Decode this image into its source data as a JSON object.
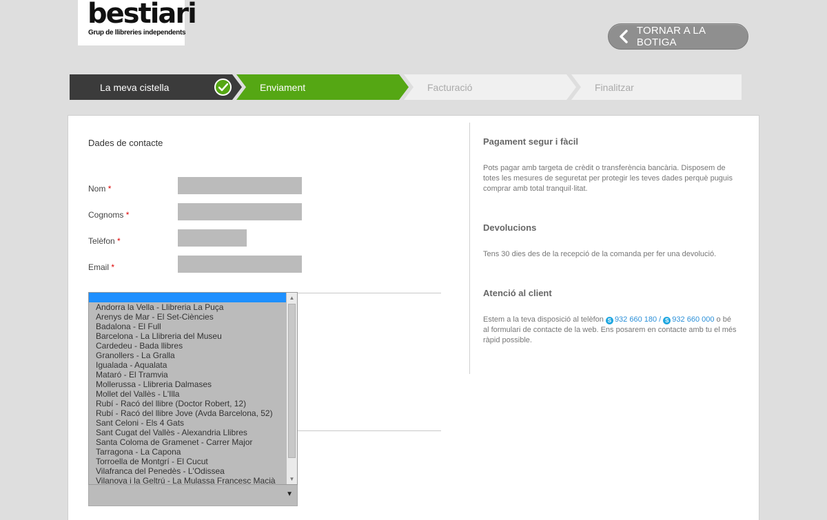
{
  "logo": {
    "word": "bestiari",
    "tagline": "Grup de llibreries independents"
  },
  "header": {
    "back_label": "TORNAR A LA BOTIGA"
  },
  "steps": [
    {
      "label": "La meva cistella",
      "state": "done"
    },
    {
      "label": "Enviament",
      "state": "active"
    },
    {
      "label": "Facturació",
      "state": "pending"
    },
    {
      "label": "Finalitzar",
      "state": "pending"
    }
  ],
  "contact": {
    "title": "Dades de contacte",
    "fields": [
      {
        "label": "Nom",
        "required": "*",
        "value": ""
      },
      {
        "label": "Cognoms",
        "required": "*",
        "value": ""
      },
      {
        "label": "Telèfon",
        "required": "*",
        "value": ""
      },
      {
        "label": "Email",
        "required": "*",
        "value": ""
      }
    ]
  },
  "store_select": {
    "options": [
      "Andorra la Vella - Llibreria La Puça",
      "Arenys de Mar - El Set-Ciències",
      "Badalona - El Full",
      "Barcelona - La Llibreria del Museu",
      "Cardedeu - Bada llibres",
      "Granollers - La Gralla",
      "Igualada - Aqualata",
      "Mataró - El Tramvia",
      "Mollerussa - Llibreria Dalmases",
      "Mollet del Vallès - L'Illa",
      "Rubí - Racó del llibre (Doctor Robert, 12)",
      "Rubí - Racó del llibre Jove (Avda Barcelona, 52)",
      "Sant Celoni - Els 4 Gats",
      "Sant Cugat del Vallès - Alexandria Llibres",
      "Santa Coloma de Gramenet - Carrer Major",
      "Tarragona - La Capona",
      "Torroella de Montgrí - El Cucut",
      "Vilafranca del Penedès - L'Odissea",
      "Vilanova i la Geltrú - La Mulassa Francesc Macià"
    ]
  },
  "sidebar": {
    "secure": {
      "title": "Pagament segur i fàcil",
      "text": "Pots pagar amb targeta de crèdit o transferència bancària. Disposem de totes les mesures de seguretat per protegir les teves dades perquè puguis comprar amb total tranquil·litat."
    },
    "returns": {
      "title": "Devolucions",
      "text": "Tens 30 dies des de la recepció de la comanda per fer una devolució."
    },
    "support": {
      "title": "Atenció al client",
      "text_before": "Estem a la teva disposició al telèfon",
      "phone1": "932 660 180",
      "sep": "/",
      "phone2": "932 660 000",
      "text_after": "o bé al formulari de contacte de la web. Ens posarem en contacte amb tu el més ràpid possible."
    }
  },
  "colors": {
    "accent_green": "#55a714",
    "dark_step": "#3b3b3b",
    "link_blue": "#2a8fd8"
  },
  "icons": {
    "back": "chevron-left-icon",
    "done": "check-icon",
    "phone": "skype-icon"
  }
}
